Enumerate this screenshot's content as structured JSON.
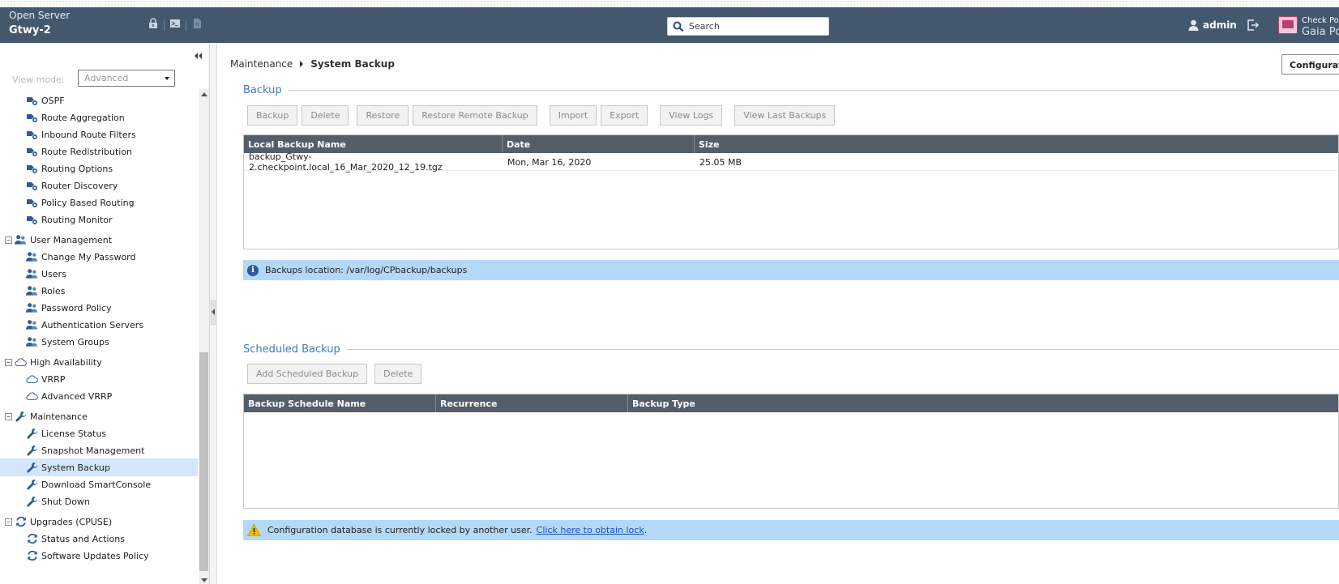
{
  "header": {
    "server_label": "Open Server",
    "gateway_name": "Gtwy-2",
    "search_placeholder": "Search",
    "user": "admin",
    "brand_line1": "Check Point",
    "brand_line2": "Gaia Portal"
  },
  "sidebar": {
    "view_mode_label": "View mode:",
    "view_mode_value": "Advanced",
    "tree": [
      {
        "label": "OSPF",
        "icon": "route-icon",
        "level": 1
      },
      {
        "label": "Route Aggregation",
        "icon": "route-icon",
        "level": 1
      },
      {
        "label": "Inbound Route Filters",
        "icon": "route-icon",
        "level": 1
      },
      {
        "label": "Route Redistribution",
        "icon": "route-icon",
        "level": 1
      },
      {
        "label": "Routing Options",
        "icon": "route-icon",
        "level": 1
      },
      {
        "label": "Router Discovery",
        "icon": "route-icon",
        "level": 1
      },
      {
        "label": "Policy Based Routing",
        "icon": "route-icon",
        "level": 1
      },
      {
        "label": "Routing Monitor",
        "icon": "route-icon",
        "level": 1
      },
      {
        "label": "User Management",
        "icon": "users-icon",
        "level": 0,
        "expander": "−"
      },
      {
        "label": "Change My Password",
        "icon": "users-icon",
        "level": 1
      },
      {
        "label": "Users",
        "icon": "users-icon",
        "level": 1
      },
      {
        "label": "Roles",
        "icon": "users-icon",
        "level": 1
      },
      {
        "label": "Password Policy",
        "icon": "users-icon",
        "level": 1
      },
      {
        "label": "Authentication Servers",
        "icon": "users-icon",
        "level": 1
      },
      {
        "label": "System Groups",
        "icon": "users-icon",
        "level": 1
      },
      {
        "label": "High Availability",
        "icon": "cloud-icon",
        "level": 0,
        "expander": "−"
      },
      {
        "label": "VRRP",
        "icon": "cloud-icon",
        "level": 1
      },
      {
        "label": "Advanced VRRP",
        "icon": "cloud-icon",
        "level": 1
      },
      {
        "label": "Maintenance",
        "icon": "wrench-icon",
        "level": 0,
        "expander": "−"
      },
      {
        "label": "License Status",
        "icon": "wrench-icon",
        "level": 1
      },
      {
        "label": "Snapshot Management",
        "icon": "wrench-icon",
        "level": 1
      },
      {
        "label": "System Backup",
        "icon": "wrench-icon",
        "level": 1,
        "selected": true
      },
      {
        "label": "Download SmartConsole",
        "icon": "wrench-icon",
        "level": 1
      },
      {
        "label": "Shut Down",
        "icon": "wrench-icon",
        "level": 1
      },
      {
        "label": "Upgrades (CPUSE)",
        "icon": "refresh-icon",
        "level": 0,
        "expander": "−"
      },
      {
        "label": "Status and Actions",
        "icon": "refresh-icon",
        "level": 1
      },
      {
        "label": "Software Updates Policy",
        "icon": "refresh-icon",
        "level": 1
      }
    ]
  },
  "breadcrumb": {
    "parent": "Maintenance",
    "current": "System Backup"
  },
  "configuration_button": "Configuration",
  "backup": {
    "title": "Backup",
    "buttons": [
      "Backup",
      "Delete",
      "Restore",
      "Restore Remote Backup",
      "Import",
      "Export",
      "View Logs",
      "View Last Backups"
    ],
    "columns": [
      "Local Backup Name",
      "Date",
      "Size"
    ],
    "rows": [
      [
        "backup_Gtwy-2.checkpoint.local_16_Mar_2020_12_19.tgz",
        "Mon, Mar 16, 2020",
        "25.05 MB"
      ]
    ],
    "location_text": "Backups location: /var/log/CPbackup/backups"
  },
  "scheduled": {
    "title": "Scheduled Backup",
    "buttons": [
      "Add Scheduled Backup",
      "Delete"
    ],
    "columns": [
      "Backup Schedule Name",
      "Recurrence",
      "Backup Type"
    ],
    "rows": []
  },
  "warning": {
    "text": "Configuration database is currently locked by another user.",
    "link": "Click here to obtain lock",
    "suffix": "."
  },
  "colors": {
    "header_bg": "#43586d",
    "table_header_bg": "#545e6a",
    "info_bg": "#b4d8f8",
    "section_title": "#3b7cc0",
    "selected_item": "#d4e6fb"
  }
}
